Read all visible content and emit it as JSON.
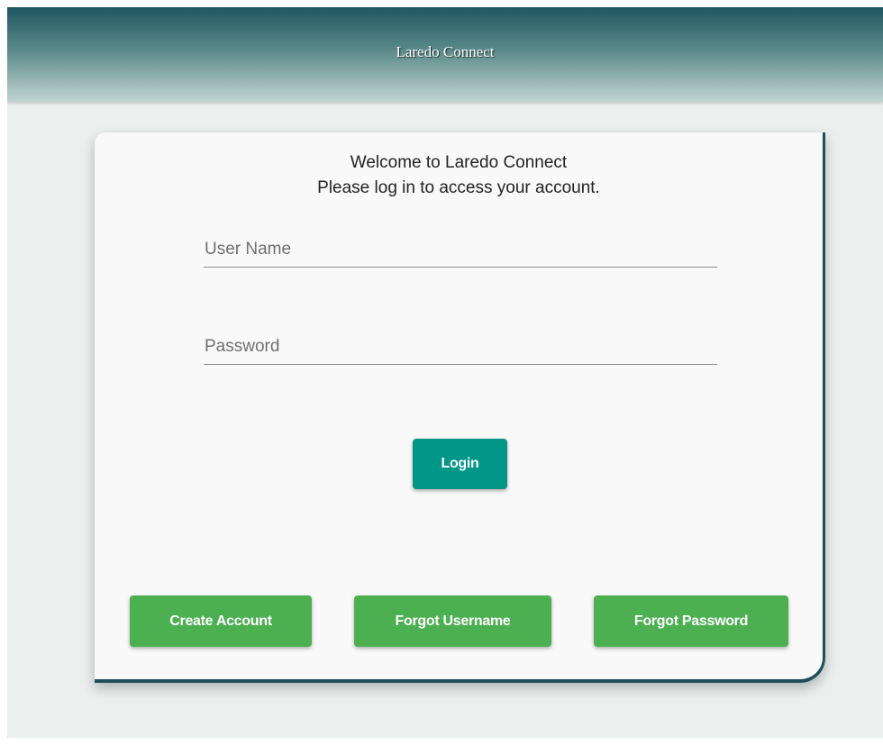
{
  "header": {
    "title": "Laredo Connect"
  },
  "login_card": {
    "welcome_line1": "Welcome to Laredo Connect",
    "welcome_line2": "Please log in to access your account.",
    "username": {
      "placeholder": "User Name",
      "value": ""
    },
    "password": {
      "placeholder": "Password",
      "value": ""
    },
    "login_label": "Login",
    "create_account_label": "Create Account",
    "forgot_username_label": "Forgot Username",
    "forgot_password_label": "Forgot Password"
  },
  "colors": {
    "header_dark": "#1f5660",
    "page_background": "#ebefee",
    "card_background": "#f9f9f9",
    "card_border": "#1f4f58",
    "login_button": "#009688",
    "secondary_buttons": "#4caf50"
  }
}
